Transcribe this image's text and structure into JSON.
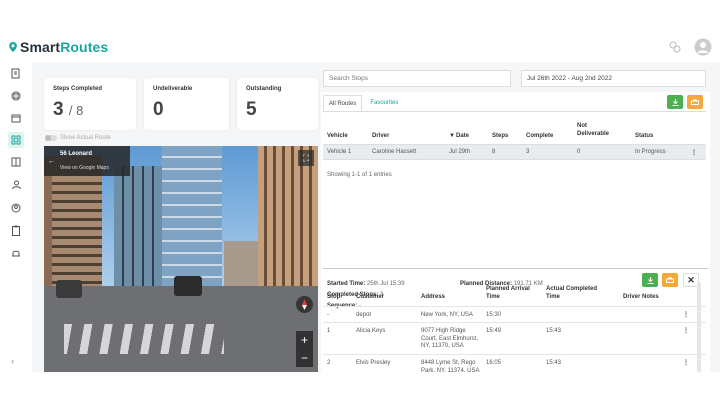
{
  "brand": {
    "name_part1": "Smart",
    "name_part2": "Routes",
    "accent": "#1aa6a0"
  },
  "topbar": {
    "icons": [
      "share-icon",
      "user-avatar-icon"
    ]
  },
  "sidebar": {
    "items": [
      "notepad-icon",
      "box-icon",
      "calendar-icon",
      "routes-icon",
      "book-icon",
      "team-icon",
      "user-icon",
      "clipboard-icon",
      "bell-icon"
    ],
    "active_index": 3,
    "collapse_glyph": "›"
  },
  "stats": [
    {
      "label": "Steps Completed",
      "value": "3",
      "total": "/ 8"
    },
    {
      "label": "Undeliverable",
      "value": "0"
    },
    {
      "label": "Outstanding",
      "value": "5"
    }
  ],
  "toggle": {
    "label": "Show Actual Route",
    "checked": false
  },
  "streetview": {
    "title": "56 Leonard",
    "link": "View on Google Maps",
    "zoom_in": "+",
    "zoom_out": "−"
  },
  "filters": {
    "search_placeholder": "Search Stops",
    "date_range": "Jul 26th 2022 - Aug 2nd 2022"
  },
  "tabs": [
    {
      "label": "All Routes",
      "active": true
    },
    {
      "label": "Favourites",
      "active": false
    }
  ],
  "routes_table": {
    "headers": {
      "vehicle": "Vehicle",
      "driver": "Driver",
      "date": "Date",
      "date_sort": "▼",
      "steps": "Steps",
      "complete": "Complete",
      "not_deliverable": "Not Deliverable",
      "status": "Status"
    },
    "rows": [
      {
        "vehicle": "Vehicle 1",
        "driver": "Caroline Hassett",
        "date": "Jul 29th",
        "steps": "8",
        "complete": "3",
        "not_deliverable": "0",
        "status": "In Progress",
        "menu": "⋮"
      }
    ],
    "showing": "Showing 1-1 of 1 entries"
  },
  "route_detail": {
    "started_label": "Started Time:",
    "started_value": "25th Jul 15:39",
    "distance_label": "Planned Distance:",
    "distance_value": "191.71 KM",
    "completed_label": "Completed Stops:",
    "completed_value": "3",
    "sequence_label": "Sequence:",
    "sequence_value": "-",
    "close_glyph": "✕"
  },
  "stops_table": {
    "headers": {
      "stop": "Stop",
      "customer": "Customer",
      "address": "Address",
      "planned": "Planned Arrival Time",
      "actual": "Actual Completed Time",
      "notes": "Driver Notes"
    },
    "rows": [
      {
        "stop": "-",
        "customer": "depot",
        "address": "New York, NY, USA",
        "planned": "15:30",
        "actual": "",
        "notes": "",
        "menu": "⋮"
      },
      {
        "stop": "1",
        "customer": "Alicia Keys",
        "address": "9077 High Ridge Court, East Elmhurst, NY, 11370, USA",
        "planned": "15:49",
        "actual": "15:43",
        "notes": "",
        "menu": "⋮"
      },
      {
        "stop": "2",
        "customer": "Elvis Presley",
        "address": "8448 Lyme St, Rego Park, NY, 11374, USA",
        "planned": "16:05",
        "actual": "15:43",
        "notes": "",
        "menu": "⋮"
      }
    ]
  },
  "colors": {
    "green": "#4caf50",
    "orange": "#f4a93a",
    "teal": "#1aa6a0"
  }
}
